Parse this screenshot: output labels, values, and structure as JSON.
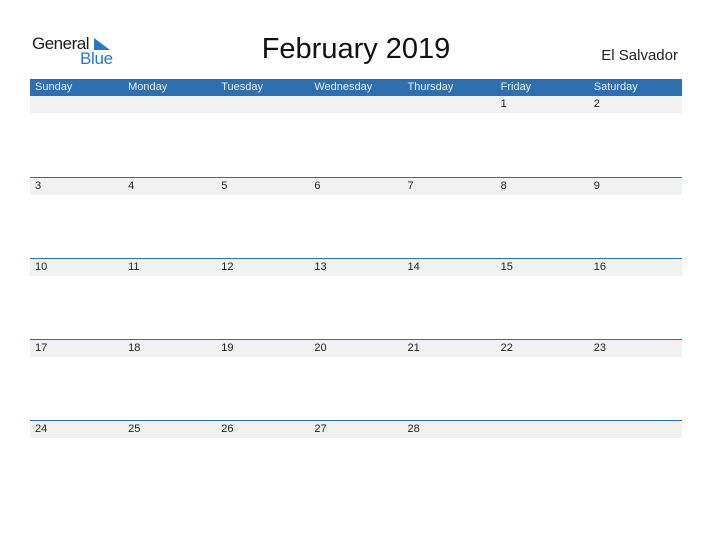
{
  "logo": {
    "general": "General",
    "blue": "Blue"
  },
  "header": {
    "title": "February 2019",
    "country": "El Salvador"
  },
  "colors": {
    "accent": "#2e6fb0",
    "strip": "#f1f1f1",
    "logo_blue": "#2a78c2"
  },
  "weekdays": [
    "Sunday",
    "Monday",
    "Tuesday",
    "Wednesday",
    "Thursday",
    "Friday",
    "Saturday"
  ],
  "weeks": [
    [
      "",
      "",
      "",
      "",
      "",
      "1",
      "2"
    ],
    [
      "3",
      "4",
      "5",
      "6",
      "7",
      "8",
      "9"
    ],
    [
      "10",
      "11",
      "12",
      "13",
      "14",
      "15",
      "16"
    ],
    [
      "17",
      "18",
      "19",
      "20",
      "21",
      "22",
      "23"
    ],
    [
      "24",
      "25",
      "26",
      "27",
      "28",
      "",
      ""
    ]
  ]
}
